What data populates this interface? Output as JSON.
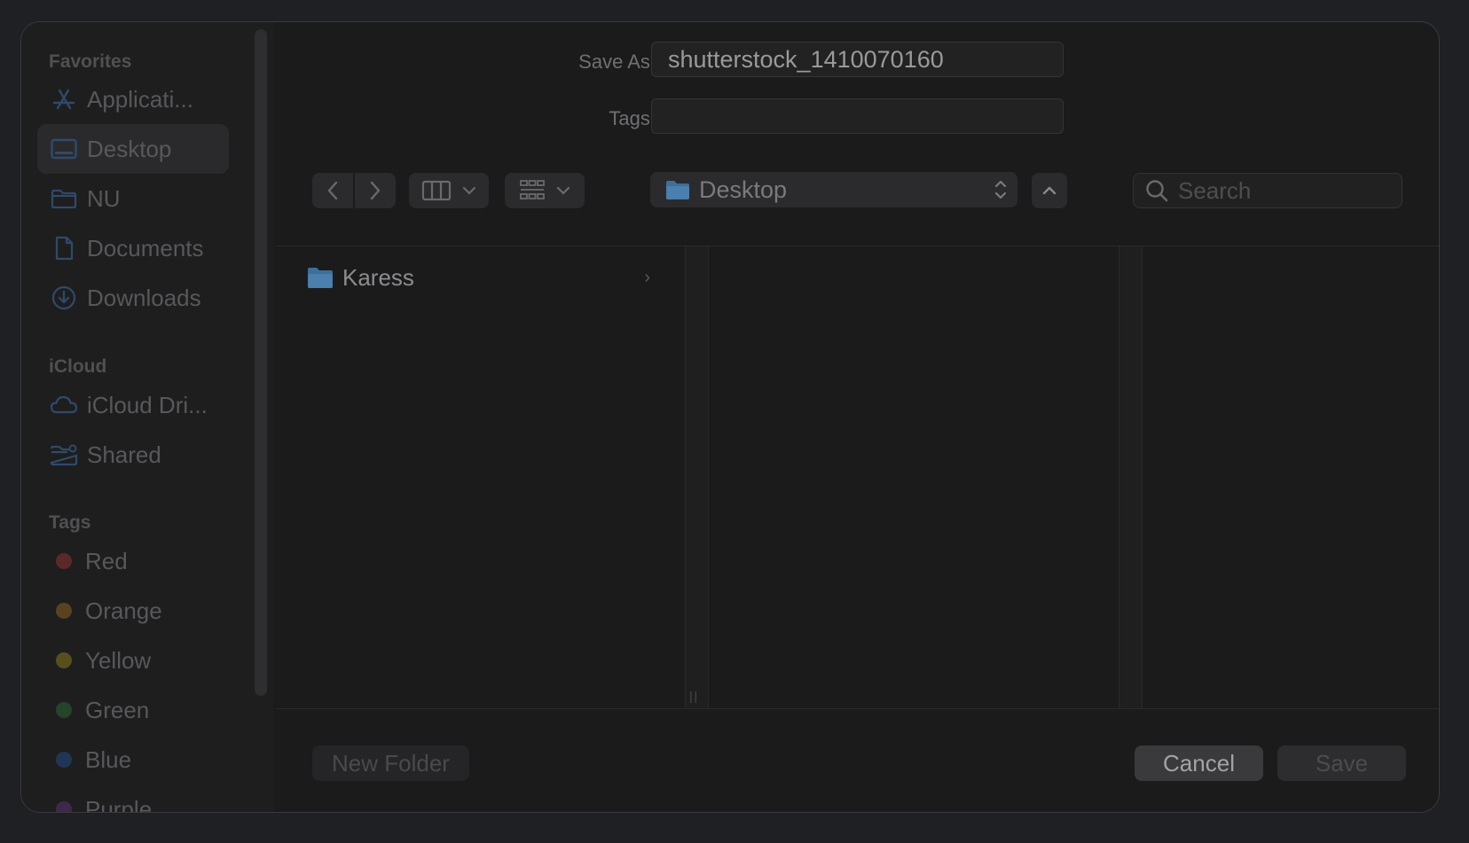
{
  "sidebar": {
    "favorites_label": "Favorites",
    "favorites": [
      {
        "label": "Applicati...",
        "icon": "applications-icon"
      },
      {
        "label": "Desktop",
        "icon": "desktop-icon",
        "selected": true
      },
      {
        "label": "NU",
        "icon": "folder-icon"
      },
      {
        "label": "Documents",
        "icon": "document-icon"
      },
      {
        "label": "Downloads",
        "icon": "downloads-icon"
      }
    ],
    "icloud_label": "iCloud",
    "icloud": [
      {
        "label": "iCloud Dri...",
        "icon": "cloud-icon"
      },
      {
        "label": "Shared",
        "icon": "shared-folder-icon"
      }
    ],
    "tags_label": "Tags",
    "tags": [
      {
        "label": "Red",
        "color": "#5a2a28"
      },
      {
        "label": "Orange",
        "color": "#5a4220"
      },
      {
        "label": "Yellow",
        "color": "#57501e"
      },
      {
        "label": "Green",
        "color": "#24452a"
      },
      {
        "label": "Blue",
        "color": "#1f3656"
      },
      {
        "label": "Purple",
        "color": "#40284d"
      }
    ]
  },
  "form": {
    "save_as_label": "Save As:",
    "save_as_value": "shutterstock_1410070160",
    "tags_label": "Tags:",
    "tags_value": ""
  },
  "toolbar": {
    "location": "Desktop",
    "search_placeholder": "Search"
  },
  "browser": {
    "items": [
      {
        "label": "Karess",
        "icon": "folder-icon"
      }
    ]
  },
  "buttons": {
    "new_folder": "New Folder",
    "cancel": "Cancel",
    "save": "Save"
  },
  "colors": {
    "folder_blue": "#3e6f9b",
    "background": "#1b1b1c"
  }
}
